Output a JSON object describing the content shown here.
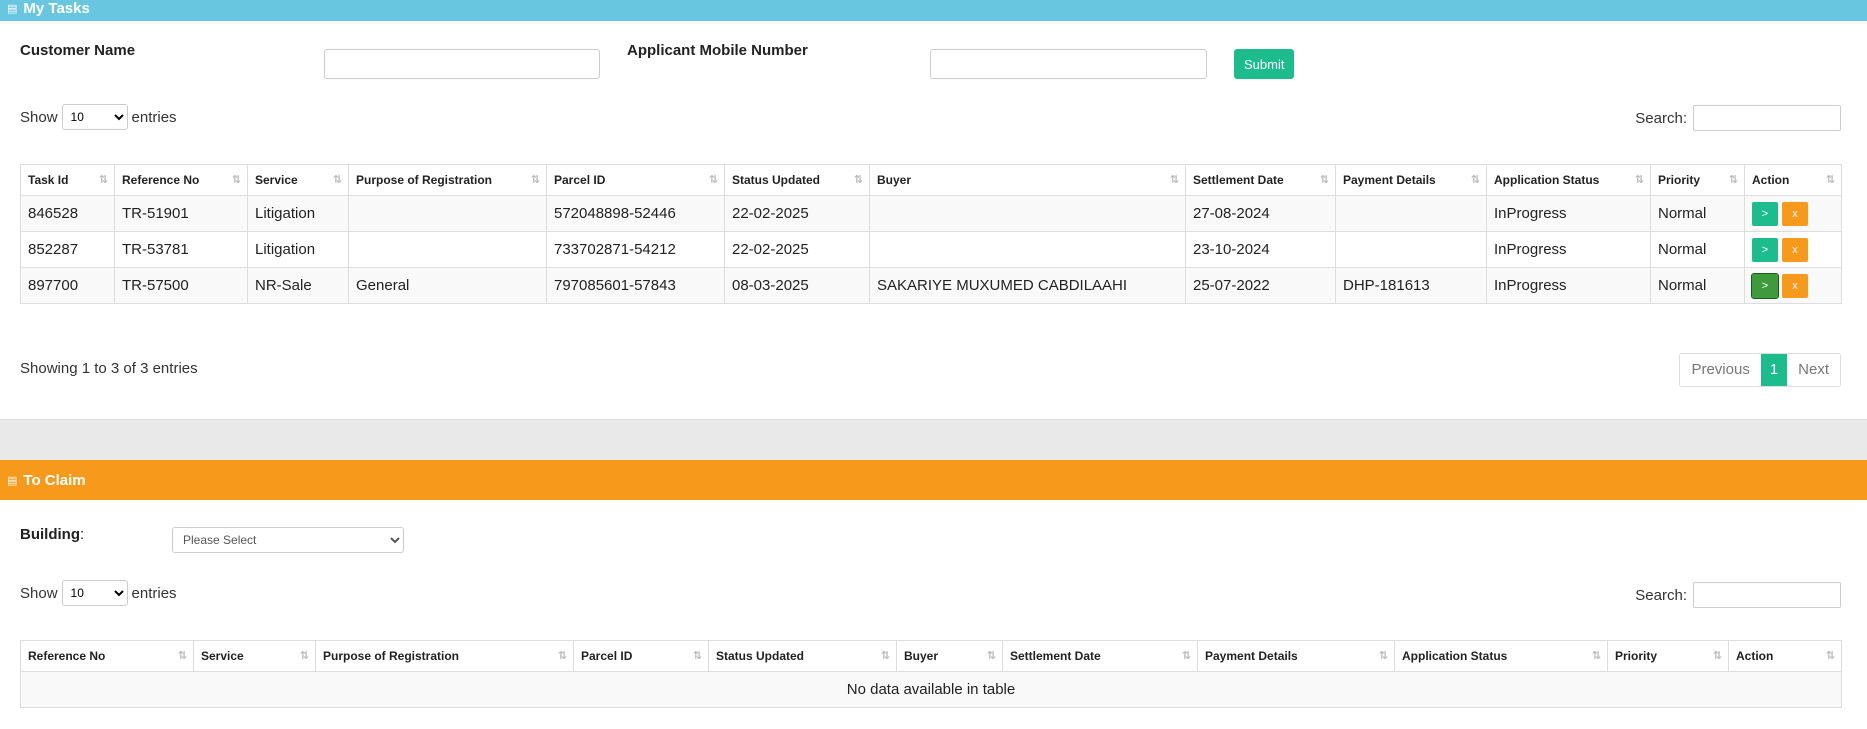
{
  "my_tasks": {
    "title": "My Tasks",
    "customer_name_label": "Customer Name",
    "mobile_label": "Applicant Mobile Number",
    "submit_label": "Submit",
    "show_label": "Show",
    "entries_label": "entries",
    "page_size": "10",
    "search_label": "Search:",
    "columns": [
      "Task Id",
      "Reference No",
      "Service",
      "Purpose of Registration",
      "Parcel ID",
      "Status Updated",
      "Buyer",
      "Settlement Date",
      "Payment Details",
      "Application Status",
      "Priority",
      "Action"
    ],
    "rows": [
      {
        "task_id": "846528",
        "reference_no": "TR-51901",
        "service": "Litigation",
        "purpose": "",
        "parcel_id": "572048898-52446",
        "status_updated": "22-02-2025",
        "buyer": "",
        "settlement_date": "27-08-2024",
        "payment_details": "",
        "application_status": "InProgress",
        "priority": "Normal"
      },
      {
        "task_id": "852287",
        "reference_no": "TR-53781",
        "service": "Litigation",
        "purpose": "",
        "parcel_id": "733702871-54212",
        "status_updated": "22-02-2025",
        "buyer": "",
        "settlement_date": "23-10-2024",
        "payment_details": "",
        "application_status": "InProgress",
        "priority": "Normal"
      },
      {
        "task_id": "897700",
        "reference_no": "TR-57500",
        "service": "NR-Sale",
        "purpose": "General",
        "parcel_id": "797085601-57843",
        "status_updated": "08-03-2025",
        "buyer": "SAKARIYE MUXUMED CABDILAAHI",
        "settlement_date": "25-07-2022",
        "payment_details": "DHP-181613",
        "application_status": "InProgress",
        "priority": "Normal"
      }
    ],
    "action_go": ">",
    "action_cancel": "x",
    "info": "Showing 1 to 3 of 3 entries",
    "pager": {
      "previous": "Previous",
      "current": "1",
      "next": "Next"
    }
  },
  "to_claim": {
    "title": "To Claim",
    "building_label": "Building",
    "building_colon": ":",
    "building_selected": "Please Select",
    "show_label": "Show",
    "entries_label": "entries",
    "page_size": "10",
    "search_label": "Search:",
    "columns": [
      "Reference No",
      "Service",
      "Purpose of Registration",
      "Parcel ID",
      "Status Updated",
      "Buyer",
      "Settlement Date",
      "Payment Details",
      "Application Status",
      "Priority",
      "Action"
    ],
    "empty_text": "No data available in table"
  },
  "colors": {
    "blue_header": "#69c6e0",
    "orange_header": "#f79a1c",
    "primary_green": "#1cbc8c"
  },
  "icons": {
    "panel_icon": "id-card-icon",
    "sort_icon": "sort-arrows-icon",
    "select_caret": "chevron-down-icon"
  }
}
